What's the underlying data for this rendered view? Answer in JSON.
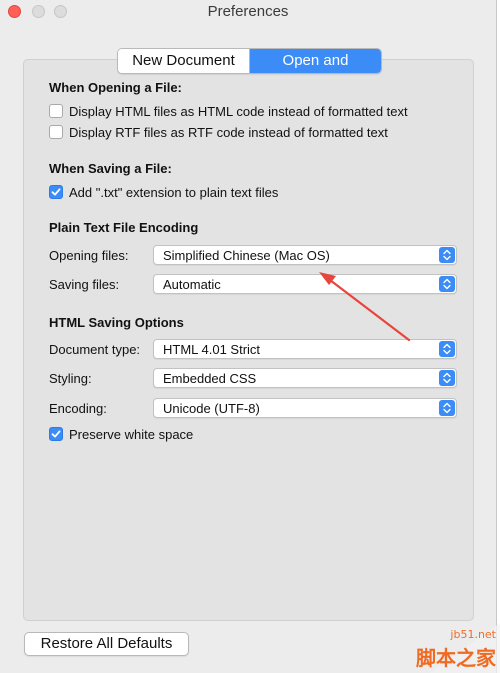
{
  "window": {
    "title": "Preferences"
  },
  "tabs": [
    {
      "label": "New Document",
      "active": false
    },
    {
      "label": "Open and Save",
      "active": true
    }
  ],
  "opening": {
    "heading": "When Opening a File:",
    "options": [
      {
        "label": "Display HTML files as HTML code instead of formatted text",
        "checked": false
      },
      {
        "label": "Display RTF files as RTF code instead of formatted text",
        "checked": false
      }
    ]
  },
  "saving": {
    "heading": "When Saving a File:",
    "options": [
      {
        "label": "Add \".txt\" extension to plain text files",
        "checked": true
      }
    ]
  },
  "encoding_section": {
    "heading": "Plain Text File Encoding",
    "opening_label": "Opening files:",
    "opening_value": "Simplified Chinese (Mac OS)",
    "saving_label": "Saving files:",
    "saving_value": "Automatic"
  },
  "html_section": {
    "heading": "HTML Saving Options",
    "doc_type_label": "Document type:",
    "doc_type_value": "HTML 4.01 Strict",
    "styling_label": "Styling:",
    "styling_value": "Embedded CSS",
    "encoding_label": "Encoding:",
    "encoding_value": "Unicode (UTF-8)",
    "preserve_label": "Preserve white space",
    "preserve_checked": true
  },
  "footer": {
    "restore_label": "Restore All Defaults"
  },
  "watermark": {
    "url": "jb51.net",
    "name": "脚本之家"
  },
  "colors": {
    "accent": "#3b8cf6",
    "annotation": "#e8453c",
    "close": "#ff5f57"
  }
}
